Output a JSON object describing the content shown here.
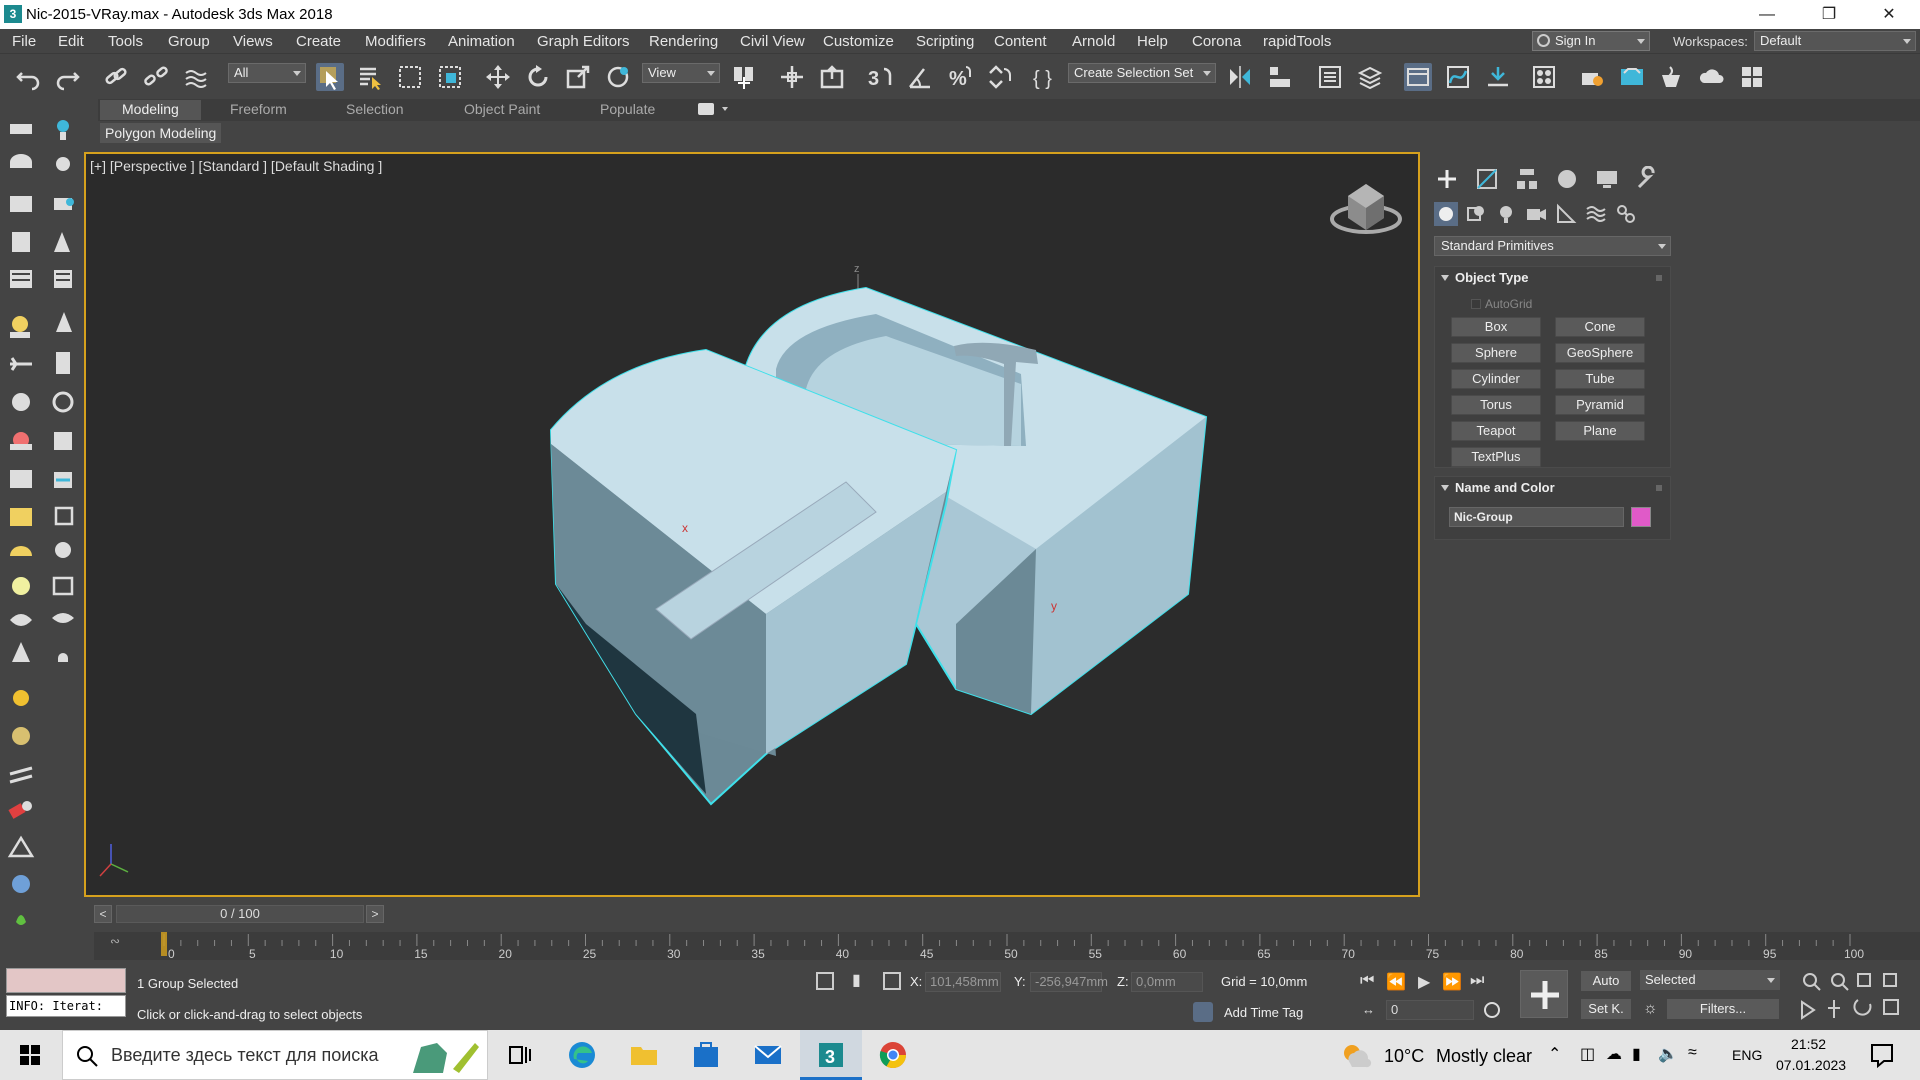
{
  "window": {
    "title": "Nic-2015-VRay.max - Autodesk 3ds Max 2018",
    "app_icon": "3"
  },
  "menu": [
    "File",
    "Edit",
    "Tools",
    "Group",
    "Views",
    "Create",
    "Modifiers",
    "Animation",
    "Graph Editors",
    "Rendering",
    "Civil View",
    "Customize",
    "Scripting",
    "Content",
    "Arnold",
    "Help",
    "Corona",
    "rapidTools"
  ],
  "account": {
    "sign_in": "Sign In",
    "workspaces_label": "Workspaces:",
    "workspace": "Default"
  },
  "toolbar": {
    "filter": "All",
    "ref_coord": "View",
    "selection_set": "Create Selection Set"
  },
  "ribbon": {
    "tabs": [
      "Modeling",
      "Freeform",
      "Selection",
      "Object Paint",
      "Populate"
    ],
    "sub": "Polygon Modeling"
  },
  "viewport": {
    "label": "[+] [Perspective ] [Standard ] [Default Shading ]",
    "axis_x": "x",
    "axis_y": "y",
    "axis_z": "z"
  },
  "command_panel": {
    "category": "Standard Primitives",
    "object_type": {
      "title": "Object Type",
      "autogrid": "AutoGrid",
      "buttons": [
        "Box",
        "Cone",
        "Sphere",
        "GeoSphere",
        "Cylinder",
        "Tube",
        "Torus",
        "Pyramid",
        "Teapot",
        "Plane",
        "TextPlus"
      ]
    },
    "name_color": {
      "title": "Name and Color",
      "name": "Nic-Group",
      "color": "#e05ac8"
    }
  },
  "timeline": {
    "frame": "0 / 100",
    "prev": "<",
    "next": ">",
    "ticks": [
      "0",
      "5",
      "10",
      "15",
      "20",
      "25",
      "30",
      "35",
      "40",
      "45",
      "50",
      "55",
      "60",
      "65",
      "70",
      "75",
      "80",
      "85",
      "90",
      "95",
      "100"
    ]
  },
  "status": {
    "maxscript_out": "INFO: Iterat:",
    "selection": "1 Group Selected",
    "prompt": "Click or click-and-drag to select objects",
    "x_label": "X:",
    "x_value": "101,458mm",
    "y_label": "Y:",
    "y_value": "-256,947mm",
    "z_label": "Z:",
    "z_value": "0,0mm",
    "grid": "Grid = 10,0mm",
    "add_time_tag": "Add Time Tag",
    "auto_key": "Auto",
    "set_key": "Set K.",
    "key_filter": "Selected",
    "filters": "Filters...",
    "current_frame": "0"
  },
  "taskbar": {
    "search_placeholder": "Введите здесь текст для поиска",
    "weather_temp": "10°C",
    "weather_text": "Mostly clear",
    "lang": "ENG",
    "time": "21:52",
    "date": "07.01.2023"
  }
}
